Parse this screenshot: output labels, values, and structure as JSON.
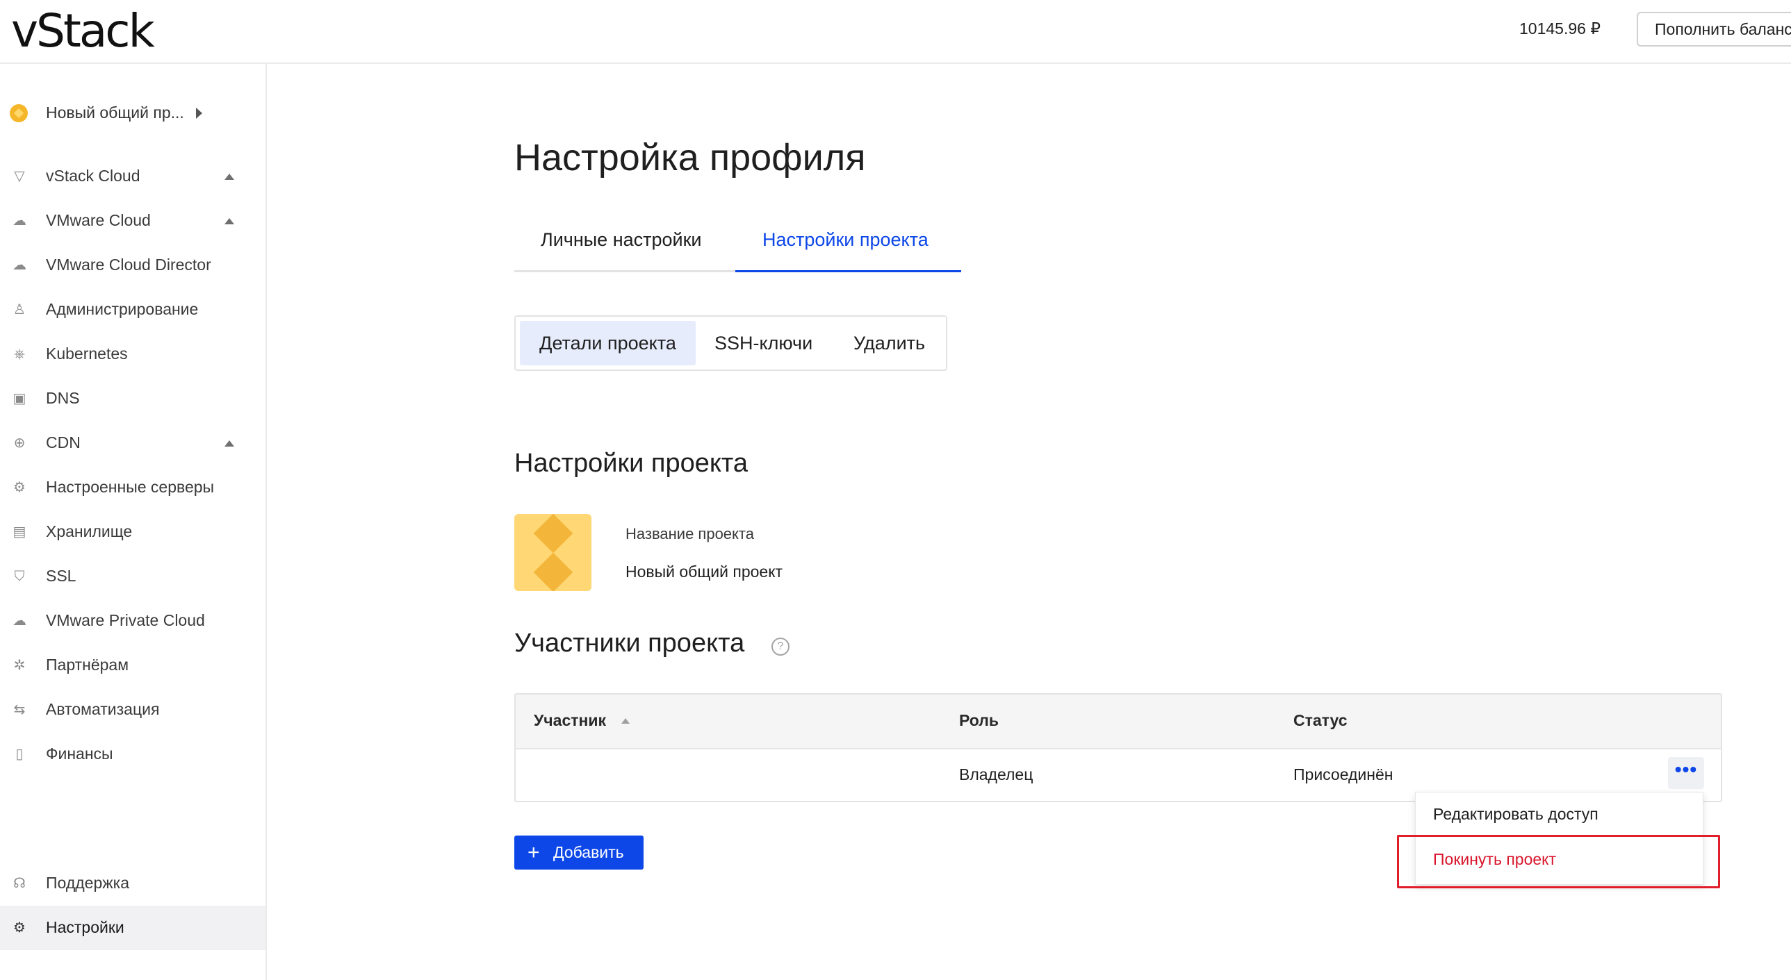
{
  "header": {
    "logo": "vStack",
    "balance": "10145.96 ₽",
    "topup_label": "Пополнить баланс"
  },
  "sidebar": {
    "project_switcher": "Новый общий пр...",
    "items": [
      {
        "label": "vStack Cloud",
        "icon": "vstack-icon",
        "expandable": true
      },
      {
        "label": "VMware Cloud",
        "icon": "cloud-icon",
        "expandable": true
      },
      {
        "label": "VMware Cloud Director",
        "icon": "cloud-director-icon"
      },
      {
        "label": "Администрирование",
        "icon": "admin-icon"
      },
      {
        "label": "Kubernetes",
        "icon": "kubernetes-icon"
      },
      {
        "label": "DNS",
        "icon": "dns-icon"
      },
      {
        "label": "CDN",
        "icon": "globe-icon",
        "expandable": true
      },
      {
        "label": "Настроенные серверы",
        "icon": "server-gear-icon"
      },
      {
        "label": "Хранилище",
        "icon": "database-icon"
      },
      {
        "label": "SSL",
        "icon": "shield-icon"
      },
      {
        "label": "VMware Private Cloud",
        "icon": "private-cloud-icon"
      },
      {
        "label": "Партнёрам",
        "icon": "partners-icon"
      },
      {
        "label": "Автоматизация",
        "icon": "automation-icon"
      },
      {
        "label": "Финансы",
        "icon": "document-icon"
      }
    ],
    "bottom_items": [
      {
        "label": "Поддержка",
        "icon": "headset-icon"
      },
      {
        "label": "Настройки",
        "icon": "gear-icon",
        "active": true
      }
    ]
  },
  "main": {
    "page_title": "Настройка профиля",
    "tabs": [
      {
        "label": "Личные настройки",
        "active": false
      },
      {
        "label": "Настройки проекта",
        "active": true
      }
    ],
    "subtabs": [
      {
        "label": "Детали проекта",
        "active": true
      },
      {
        "label": "SSH-ключи",
        "active": false
      },
      {
        "label": "Удалить",
        "active": false
      }
    ],
    "project_section_title": "Настройки проекта",
    "project_name_label": "Название проекта",
    "project_name_value": "Новый общий проект",
    "members_section_title": "Участники проекта",
    "members_table": {
      "columns": [
        "Участник",
        "Роль",
        "Статус"
      ],
      "rows": [
        {
          "member": "",
          "role": "Владелец",
          "status": "Присоединён"
        }
      ]
    },
    "row_menu": {
      "more_label": "•••",
      "items": [
        "Редактировать доступ",
        "Покинуть проект"
      ]
    },
    "add_button": {
      "icon": "+",
      "label": "Добавить"
    }
  },
  "colors": {
    "accent": "#0d47e8",
    "danger": "#d8152a",
    "highlight_box": "#e01e2a",
    "avatar_bg": "#ffd775"
  }
}
